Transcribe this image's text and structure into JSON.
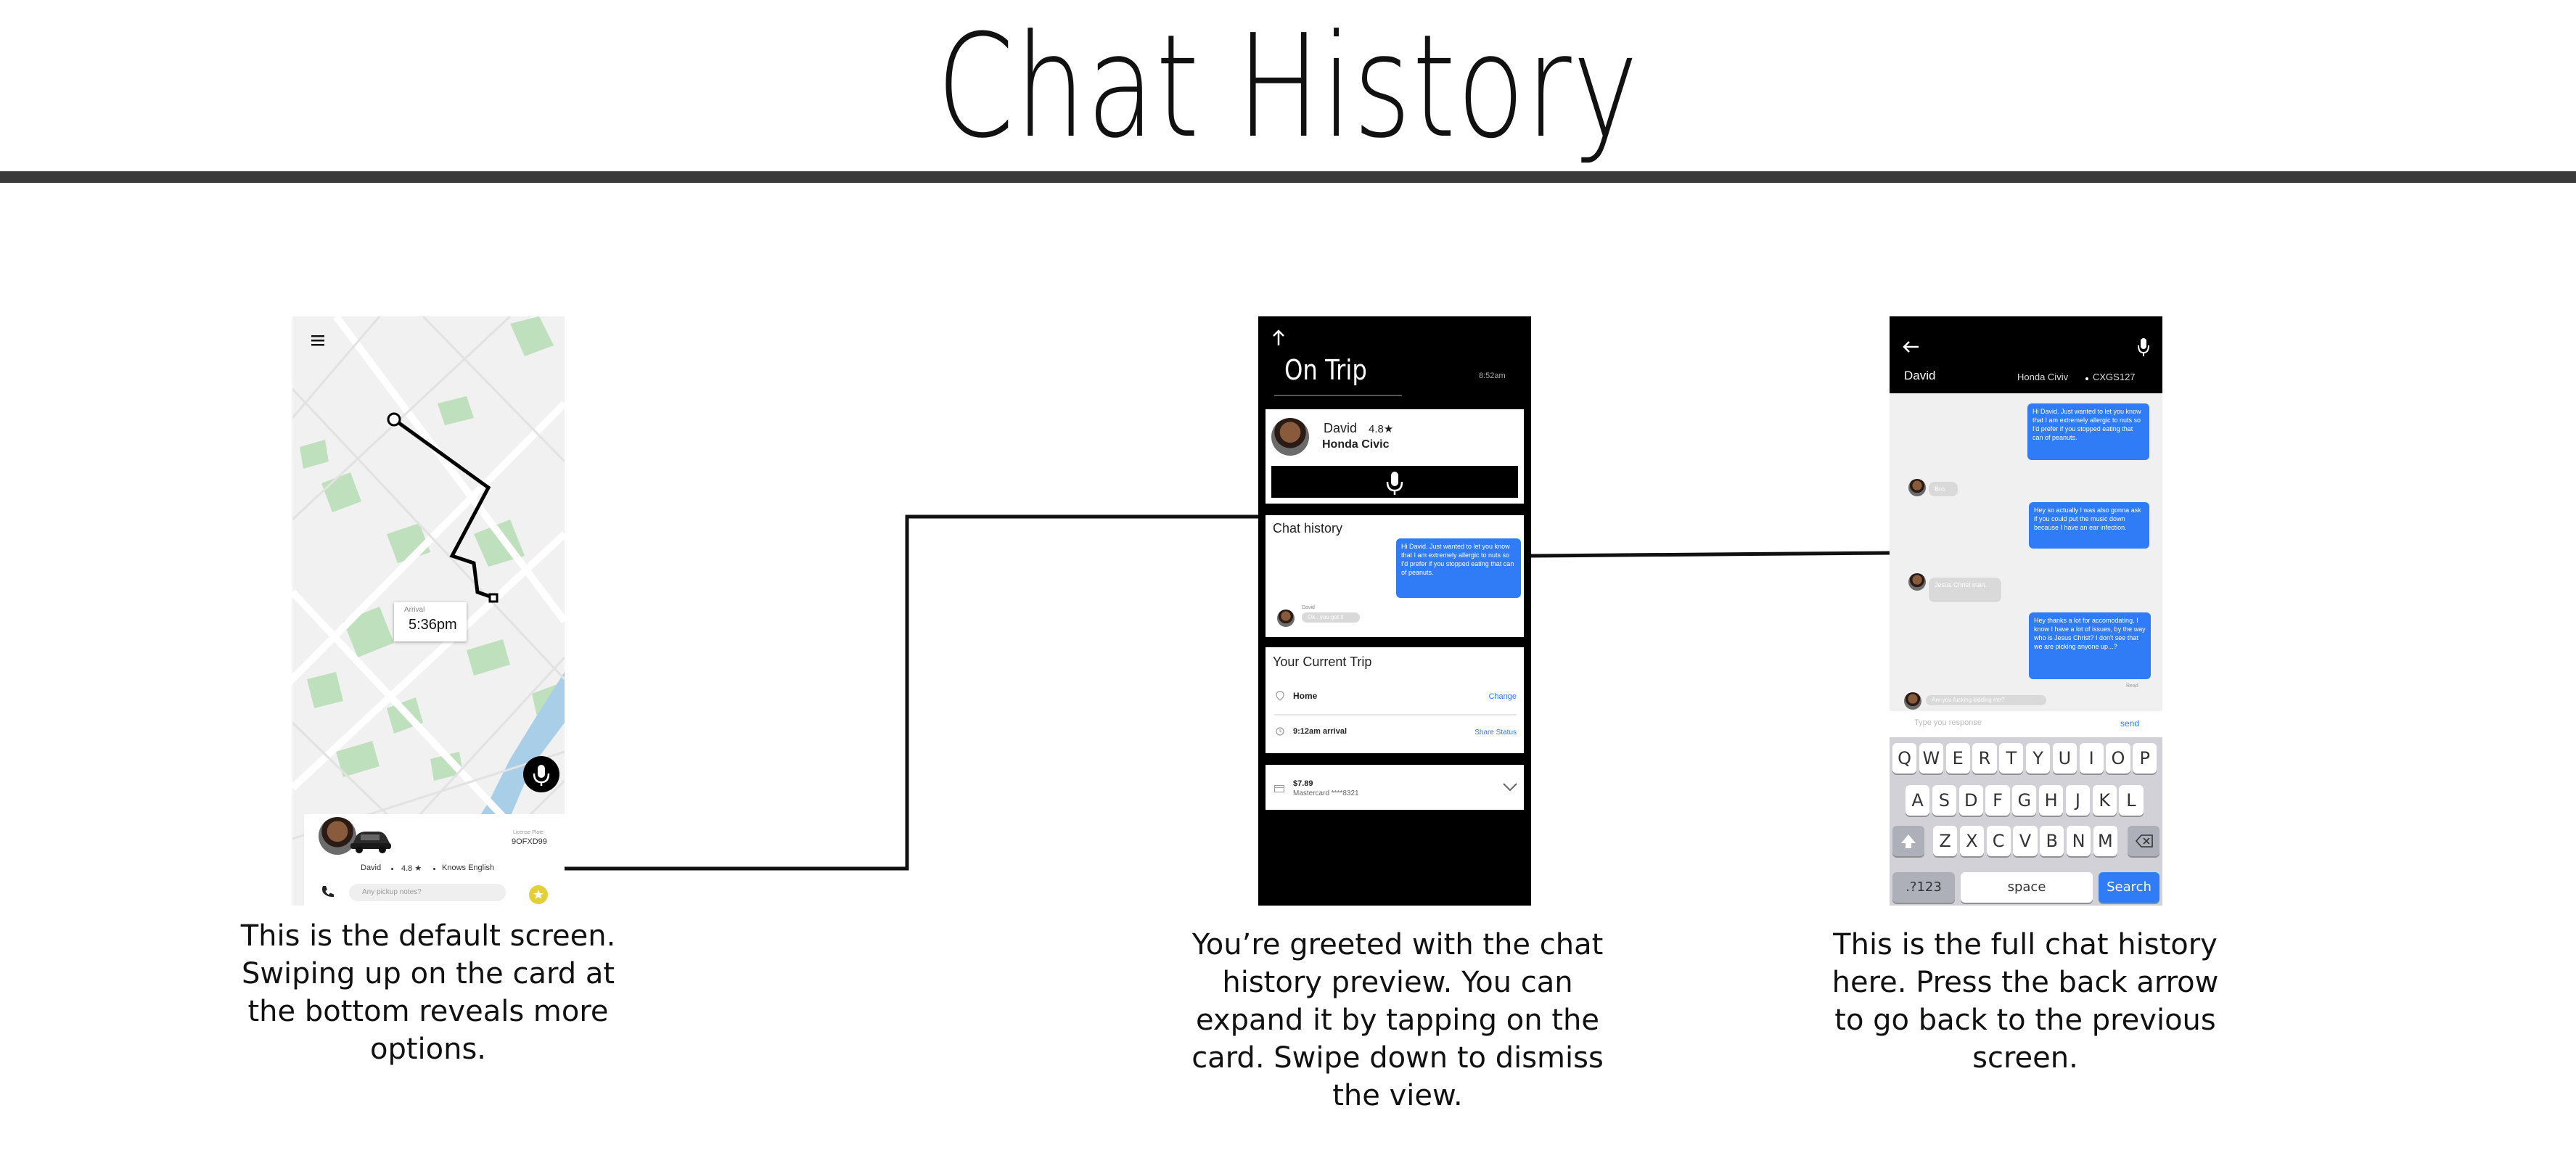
{
  "page": {
    "title": "Chat History"
  },
  "captions": {
    "left": [
      "This is the default screen.",
      "Swiping up on the card at",
      "the bottom reveals more",
      "options."
    ],
    "middle": [
      "You’re greeted with the chat",
      "history preview. You can",
      "expand it by tapping on the",
      "card. Swipe down to dismiss",
      "the view."
    ],
    "right": [
      "This is the full chat history",
      "here. Press the back arrow",
      "to go back to the previous",
      "screen."
    ]
  },
  "screen1": {
    "arrival_label": "Arrival",
    "arrival_time": "5:36pm",
    "plate_label": "License Plate",
    "plate": "9OFXD99",
    "driver_name": "David",
    "rating": "4.8 ★",
    "language": "Knows English",
    "notes_placeholder": "Any pickup notes?"
  },
  "screen2": {
    "title": "On Trip",
    "time": "8:52am",
    "driver_name": "David",
    "rating": "4.8★",
    "car": "Honda Civic",
    "chat_title": "Chat history",
    "bubble_text": "Hi David. Just wanted to let you know that I am extremely allergic to nuts so I'd prefer if you stopped eating that can of peanuts.",
    "reply_sender": "David",
    "reply_text": "Ok.. you got it",
    "trip_title": "Your Current Trip",
    "destination": "Home",
    "change_label": "Change",
    "arrival": "9:12am arrival",
    "share_label": "Share Status",
    "price": "$7.89",
    "payment": "Mastercard ****8321"
  },
  "screen3": {
    "driver_name": "David",
    "car": "Honda Civiv",
    "plate": "CXGS127",
    "messages": [
      {
        "from": "me",
        "text": "Hi David. Just wanted to let you know that I am extremely allergic to nuts so I'd prefer if you stopped eating that can of peanuts."
      },
      {
        "from": "david",
        "text": "Bro."
      },
      {
        "from": "me",
        "text": "Hey so actually I was also gonna ask if you could put the music down because I have an ear infection."
      },
      {
        "from": "david",
        "text": "Jesus Christ man."
      },
      {
        "from": "me",
        "text": "Hey thanks a lot for accomodating. I know I have a lot of issues, by the way who is Jesus Christ? I don't see that we are picking anyone up...?"
      },
      {
        "from": "david",
        "text": "Are you fucking kidding me?"
      }
    ],
    "read_label": "Read",
    "input_placeholder": "Type you response",
    "send_label": "send",
    "keyboard": {
      "row1": [
        "Q",
        "W",
        "E",
        "R",
        "T",
        "Y",
        "U",
        "I",
        "O",
        "P"
      ],
      "row2": [
        "A",
        "S",
        "D",
        "F",
        "G",
        "H",
        "J",
        "K",
        "L"
      ],
      "row3": [
        "Z",
        "X",
        "C",
        "V",
        "B",
        "N",
        "M"
      ],
      "numbers_key": ".?123",
      "space_key": "space",
      "search_key": "Search"
    }
  },
  "colors": {
    "accent_blue": "#2f7cf6",
    "map_green": "#b9dcb6",
    "map_water": "#a9cfe8",
    "rule": "#3b3b3b"
  }
}
